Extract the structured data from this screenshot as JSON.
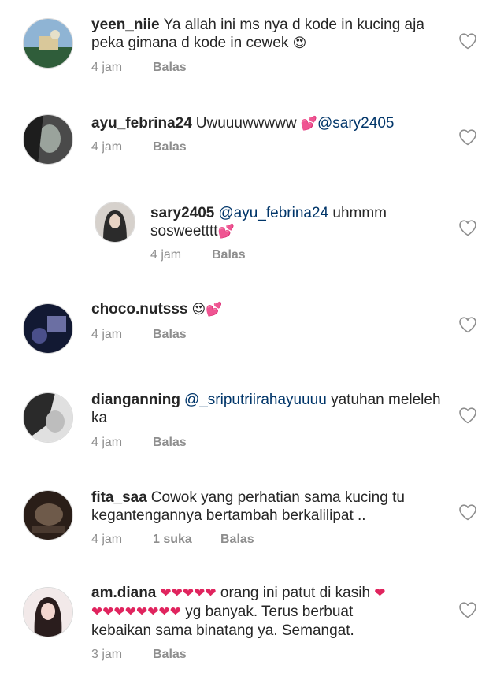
{
  "comments": [
    {
      "username": "yeen_niie",
      "segments": [
        {
          "t": "text",
          "v": "Ya allah ini ms nya d kode in kucing aja"
        },
        {
          "t": "br"
        },
        {
          "t": "text",
          "v": "peka gimana d kode in cewek "
        },
        {
          "t": "emoji",
          "v": "😍"
        }
      ],
      "time": "4 jam",
      "likes": "",
      "reply": "Balas",
      "avatar_colors": [
        "#7fa7c9",
        "#d9c89a",
        "#2f5d3a"
      ]
    },
    {
      "username": "ayu_febrina24",
      "segments": [
        {
          "t": "text",
          "v": "Uwuuuwwwww "
        },
        {
          "t": "emoji",
          "v": "💕"
        },
        {
          "t": "mention",
          "v": "@sary2405"
        }
      ],
      "time": "4 jam",
      "likes": "",
      "reply": "Balas",
      "avatar_colors": [
        "#3a3a3a",
        "#9aa39c",
        "#1d1d1d"
      ]
    },
    {
      "username": "sary2405",
      "segments": [
        {
          "t": "mention",
          "v": "@ayu_febrina24"
        },
        {
          "t": "text",
          "v": " uhmmm"
        },
        {
          "t": "br"
        },
        {
          "t": "text",
          "v": "sosweetttt"
        },
        {
          "t": "emoji",
          "v": "💕"
        }
      ],
      "time": "4 jam",
      "likes": "",
      "reply": "Balas",
      "avatar_colors": [
        "#c9c4bf",
        "#2b2b2b",
        "#e8d3c4"
      ]
    },
    {
      "username": "choco.nutsss",
      "segments": [
        {
          "t": "emoji",
          "v": "😍"
        },
        {
          "t": "emoji",
          "v": "💕"
        }
      ],
      "time": "4 jam",
      "likes": "",
      "reply": "Balas",
      "avatar_colors": [
        "#1a2240",
        "#6b6fa3",
        "#0b0f1d"
      ]
    },
    {
      "username": "dianganning",
      "segments": [
        {
          "t": "mention",
          "v": "@_sriputriirahayuuuu"
        },
        {
          "t": "text",
          "v": " yatuhan meleleh"
        },
        {
          "t": "br"
        },
        {
          "t": "text",
          "v": "ka"
        }
      ],
      "time": "4 jam",
      "likes": "",
      "reply": "Balas",
      "avatar_colors": [
        "#2a2a2a",
        "#d8d8d8",
        "#555555"
      ]
    },
    {
      "username": "fita_saa",
      "segments": [
        {
          "t": "text",
          "v": "Cowok yang perhatian sama kucing tu"
        },
        {
          "t": "br"
        },
        {
          "t": "text",
          "v": "kegantengannya bertambah berkalilipat .."
        }
      ],
      "time": "4 jam",
      "likes": "1 suka",
      "reply": "Balas",
      "avatar_colors": [
        "#3a2a22",
        "#6e5a4a",
        "#1e1410"
      ]
    },
    {
      "username": "am.diana",
      "segments": [
        {
          "t": "heart",
          "v": "❤❤❤❤❤"
        },
        {
          "t": "text",
          "v": "  orang ini patut di kasih "
        },
        {
          "t": "heart",
          "v": "❤"
        },
        {
          "t": "br"
        },
        {
          "t": "heart",
          "v": "❤❤❤❤❤❤❤❤"
        },
        {
          "t": "text",
          "v": " yg banyak. Terus berbuat"
        },
        {
          "t": "br"
        },
        {
          "t": "text",
          "v": "kebaikan sama binatang ya. Semangat."
        }
      ],
      "time": "3 jam",
      "likes": "",
      "reply": "Balas",
      "avatar_colors": [
        "#f0e6e6",
        "#2a1d1d",
        "#c98a8a"
      ]
    }
  ]
}
